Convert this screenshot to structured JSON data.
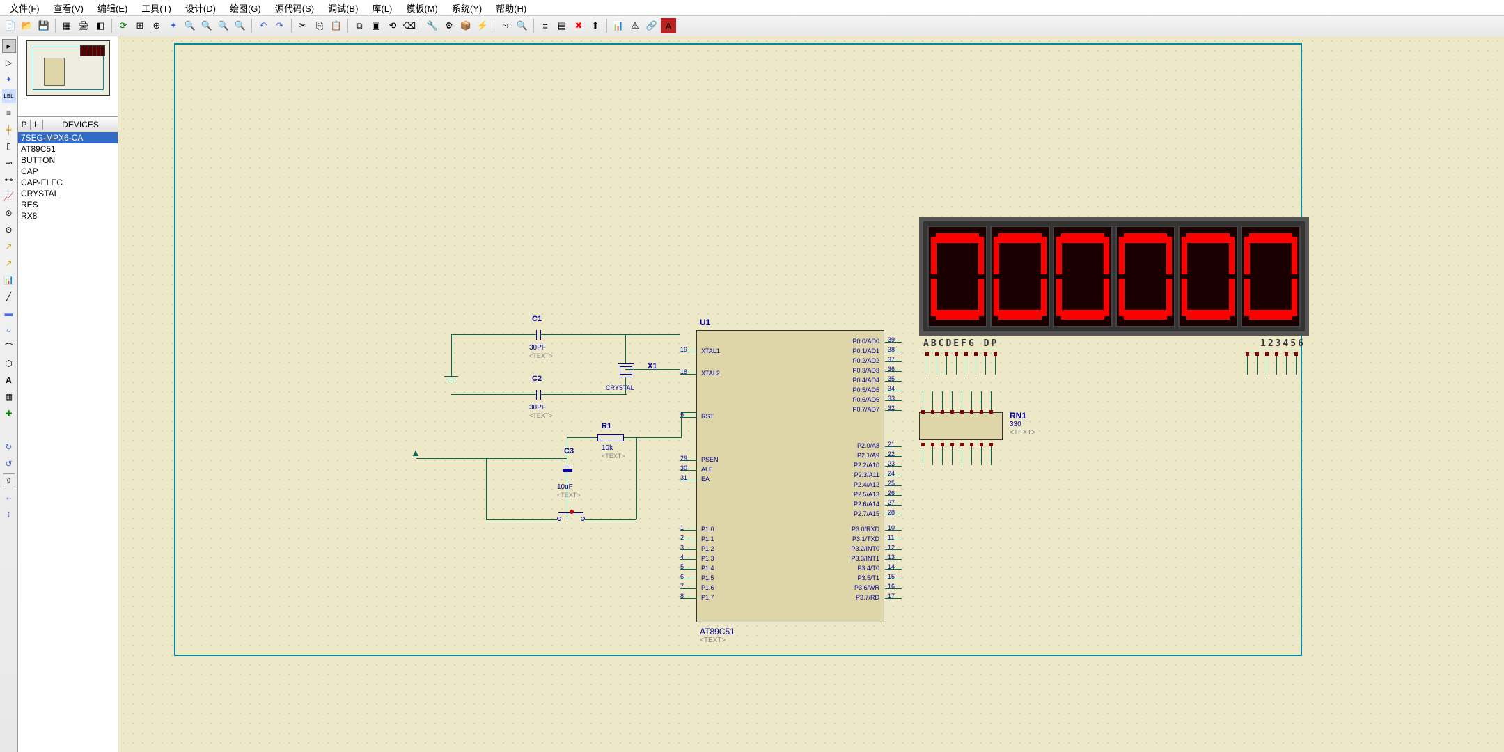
{
  "menu": {
    "file": "文件(F)",
    "view": "查看(V)",
    "edit": "编辑(E)",
    "tool": "工具(T)",
    "design": "设计(D)",
    "draw": "绘图(G)",
    "source": "源代码(S)",
    "debug": "调试(B)",
    "lib": "库(L)",
    "template": "模板(M)",
    "system": "系统(Y)",
    "help": "帮助(H)"
  },
  "devpanel": {
    "p": "P",
    "l": "L",
    "header": "DEVICES",
    "items": [
      "7SEG-MPX6-CA",
      "AT89C51",
      "BUTTON",
      "CAP",
      "CAP-ELEC",
      "CRYSTAL",
      "RES",
      "RX8"
    ],
    "selected": 0
  },
  "mcu": {
    "ref": "U1",
    "model": "AT89C51",
    "textph": "<TEXT>",
    "left_signals": [
      "XTAL1",
      "XTAL2",
      "RST",
      "PSEN",
      "ALE",
      "EA",
      "P1.0",
      "P1.1",
      "P1.2",
      "P1.3",
      "P1.4",
      "P1.5",
      "P1.6",
      "P1.7"
    ],
    "left_pins": [
      "19",
      "18",
      "9",
      "29",
      "30",
      "31",
      "1",
      "2",
      "3",
      "4",
      "5",
      "6",
      "7",
      "8"
    ],
    "right_signals": [
      "P0.0/AD0",
      "P0.1/AD1",
      "P0.2/AD2",
      "P0.3/AD3",
      "P0.4/AD4",
      "P0.5/AD5",
      "P0.6/AD6",
      "P0.7/AD7",
      "P2.0/A8",
      "P2.1/A9",
      "P2.2/A10",
      "P2.3/A11",
      "P2.4/A12",
      "P2.5/A13",
      "P2.6/A14",
      "P2.7/A15",
      "P3.0/RXD",
      "P3.1/TXD",
      "P3.2/INT0",
      "P3.3/INT1",
      "P3.4/T0",
      "P3.5/T1",
      "P3.6/WR",
      "P3.7/RD"
    ],
    "right_pins": [
      "39",
      "38",
      "37",
      "36",
      "35",
      "34",
      "33",
      "32",
      "21",
      "22",
      "23",
      "24",
      "25",
      "26",
      "27",
      "28",
      "10",
      "11",
      "12",
      "13",
      "14",
      "15",
      "16",
      "17"
    ]
  },
  "caps": {
    "c1": {
      "ref": "C1",
      "val": "30PF"
    },
    "c2": {
      "ref": "C2",
      "val": "30PF"
    },
    "c3": {
      "ref": "C3",
      "val": "10uF"
    }
  },
  "xtal": {
    "ref": "X1",
    "model": "CRYSTAL"
  },
  "res": {
    "ref": "R1",
    "val": "10k"
  },
  "rn": {
    "ref": "RN1",
    "val": "330",
    "txt": "<TEXT>"
  },
  "seg": {
    "labels": "ABCDEFG DP",
    "nums": "123456"
  },
  "txt": "<TEXT>"
}
